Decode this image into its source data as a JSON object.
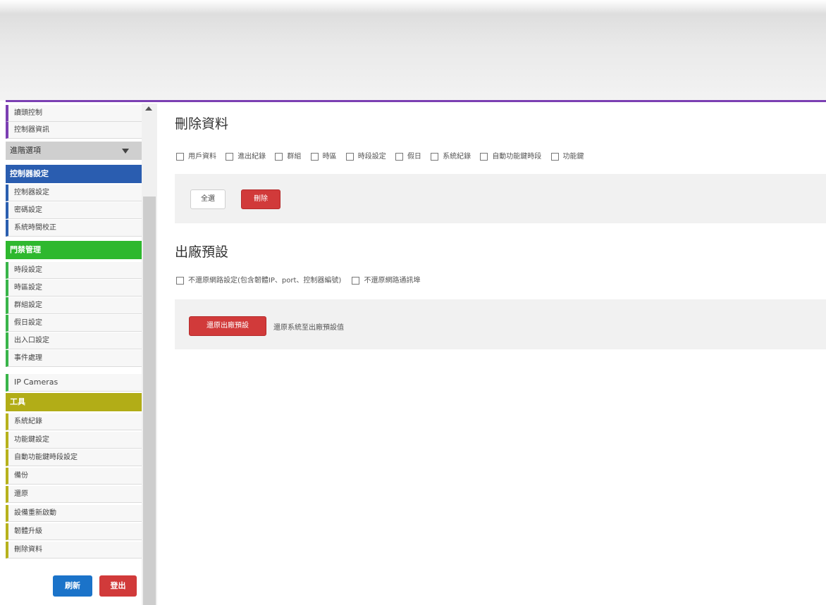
{
  "sidebar": {
    "top_items": [
      "讀頭控制",
      "控制器資訊"
    ],
    "advanced_header": "進階選項",
    "controller_header": "控制器設定",
    "controller_items": [
      "控制器設定",
      "密碼設定",
      "系統時間校正"
    ],
    "access_header": "門禁管理",
    "access_items": [
      "時段設定",
      "時區設定",
      "群組設定",
      "假日設定",
      "出入口設定",
      "事件處理",
      "IP Cameras"
    ],
    "tools_header": "工具",
    "tools_items": [
      "系統紀錄",
      "功能鍵設定",
      "自動功能鍵時段設定",
      "備份",
      "還原",
      "設備重新啟動",
      "韌體升級",
      "刪除資料"
    ],
    "refresh_label": "刷新",
    "logout_label": "登出"
  },
  "delete_section": {
    "title": "刪除資料",
    "options": [
      "用戶資料",
      "進出紀錄",
      "群組",
      "時區",
      "時段設定",
      "假日",
      "系統紀錄",
      "自動功能鍵時段",
      "功能鍵"
    ],
    "select_all_label": "全選",
    "delete_label": "刪除"
  },
  "factory_section": {
    "title": "出廠預設",
    "options": [
      "不還原網路設定(包含韌體IP、port、控制器編號)",
      "不還原網路通訊埠"
    ],
    "restore_label": "還原出廠預設",
    "restore_note": "還原系統至出廠預設值"
  },
  "colors": {
    "accent_purple": "#7b3fb3",
    "controller_blue": "#2a5db0",
    "access_green": "#2eb82e",
    "tools_olive": "#b2ad17",
    "danger_red": "#d13a3a",
    "refresh_blue": "#1b73c9"
  }
}
